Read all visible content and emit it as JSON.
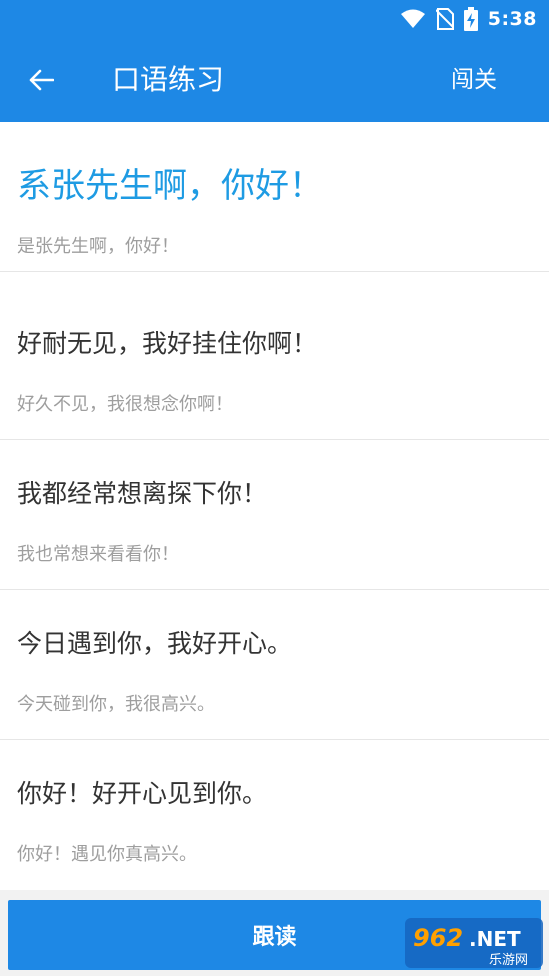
{
  "status_bar": {
    "time": "5:38"
  },
  "app_bar": {
    "title": "口语练习",
    "action_label": "闯关"
  },
  "phrases": [
    {
      "primary": "系张先生啊，你好！",
      "secondary": "是张先生啊，你好！",
      "active": true
    },
    {
      "primary": "好耐无见，我好挂住你啊！",
      "secondary": "好久不见，我很想念你啊！",
      "active": false
    },
    {
      "primary": "我都经常想离探下你！",
      "secondary": "我也常想来看看你！",
      "active": false
    },
    {
      "primary": "今日遇到你，我好开心。",
      "secondary": "今天碰到你，我很高兴。",
      "active": false
    },
    {
      "primary": "你好！好开心见到你。",
      "secondary": "你好！遇见你真高兴。",
      "active": false
    }
  ],
  "bottom": {
    "button_label": "跟读"
  },
  "watermark": {
    "brand": "962.NET",
    "sub": "乐游网"
  },
  "colors": {
    "primary": "#1e88e5",
    "active_text": "#1e9be3",
    "secondary_text": "#9e9e9e"
  }
}
